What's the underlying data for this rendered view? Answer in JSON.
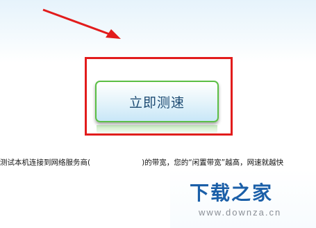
{
  "speed_test": {
    "button_label": "立即测速",
    "description_part1": "测试本机连接到网络服务商(",
    "description_part2": ")的带宽，您的“闲置带宽”越高，网速就越快"
  },
  "annotations": {
    "arrow_color": "#e21c1c",
    "highlight_color": "#e21c1c"
  },
  "watermark": {
    "title": "下载之家",
    "url": "www.downza.cn"
  }
}
